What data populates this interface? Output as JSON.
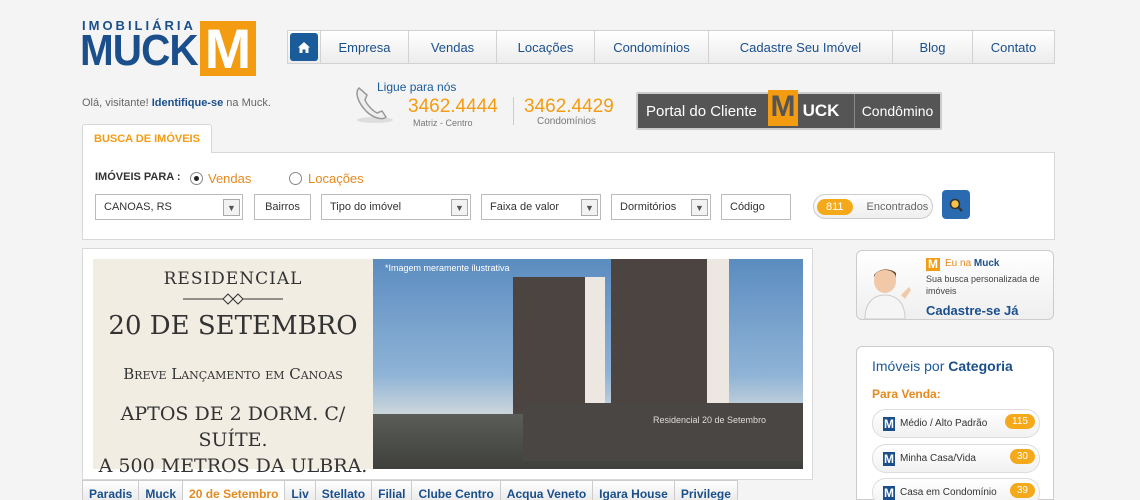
{
  "logo": {
    "top": "IMOBILIÁRIA",
    "main": "MUCK",
    "letter": "M"
  },
  "nav": {
    "items": [
      "Empresa",
      "Vendas",
      "Locações",
      "Condomínios",
      "Cadastre Seu Imóvel",
      "Blog",
      "Contato"
    ]
  },
  "greeting": {
    "prefix": "Olá, visitante!",
    "link": "Identifique-se",
    "suffix": " na Muck."
  },
  "contact": {
    "ligue": "Ligue para nós",
    "phone1": "3462.4444",
    "phone1_label": "Matriz - Centro",
    "phone2": "3462.4429",
    "phone2_label": "Condomínios"
  },
  "portal": {
    "label": "Portal do Cliente",
    "logo_letter": "M",
    "logo_text": "UCK",
    "right": "Condômino"
  },
  "search": {
    "tab": "BUSCA DE IMÓVEIS",
    "for_label": "IMÓVEIS PARA :",
    "option_vendas": "Vendas",
    "option_locacoes": "Locações",
    "city": "CANOAS, RS",
    "bairros": "Bairros",
    "tipo": "Tipo do imóvel",
    "faixa": "Faixa de valor",
    "dormitorios": "Dormitórios",
    "codigo": "Código",
    "count": "811",
    "count_label": "Encontrados"
  },
  "banner": {
    "residencial": "RESIDENCIAL",
    "date": "20 DE SETEMBRO",
    "breve": "Breve Lançamento em Canoas",
    "aptos1": "APTOS DE 2 DORM. C/ SUÍTE.",
    "aptos2": "A 500 METROS DA ULBRA.",
    "ilustrativa": "*Imagem meramente ilustrativa",
    "wall_sign": "Residencial 20 de Setembro"
  },
  "tabs": [
    "Paradis",
    "Muck",
    "20 de Setembro",
    "Liv",
    "Stellato",
    "Filial",
    "Clube Centro",
    "Acqua Veneto",
    "Igara House",
    "Privilege"
  ],
  "eu": {
    "letter": "M",
    "title_prefix": "Eu na ",
    "title_brand": "Muck",
    "desc": "Sua busca personalizada de imóveis",
    "cta": "Cadastre-se Já"
  },
  "categoria": {
    "title_prefix": "Imóveis por ",
    "title_bold": "Categoria",
    "sub": "Para Venda:",
    "items": [
      {
        "label": "Médio / Alto Padrão",
        "count": "115"
      },
      {
        "label": "Minha Casa/Vida",
        "count": "30"
      },
      {
        "label": "Casa em Condomínio",
        "count": "39"
      }
    ]
  }
}
